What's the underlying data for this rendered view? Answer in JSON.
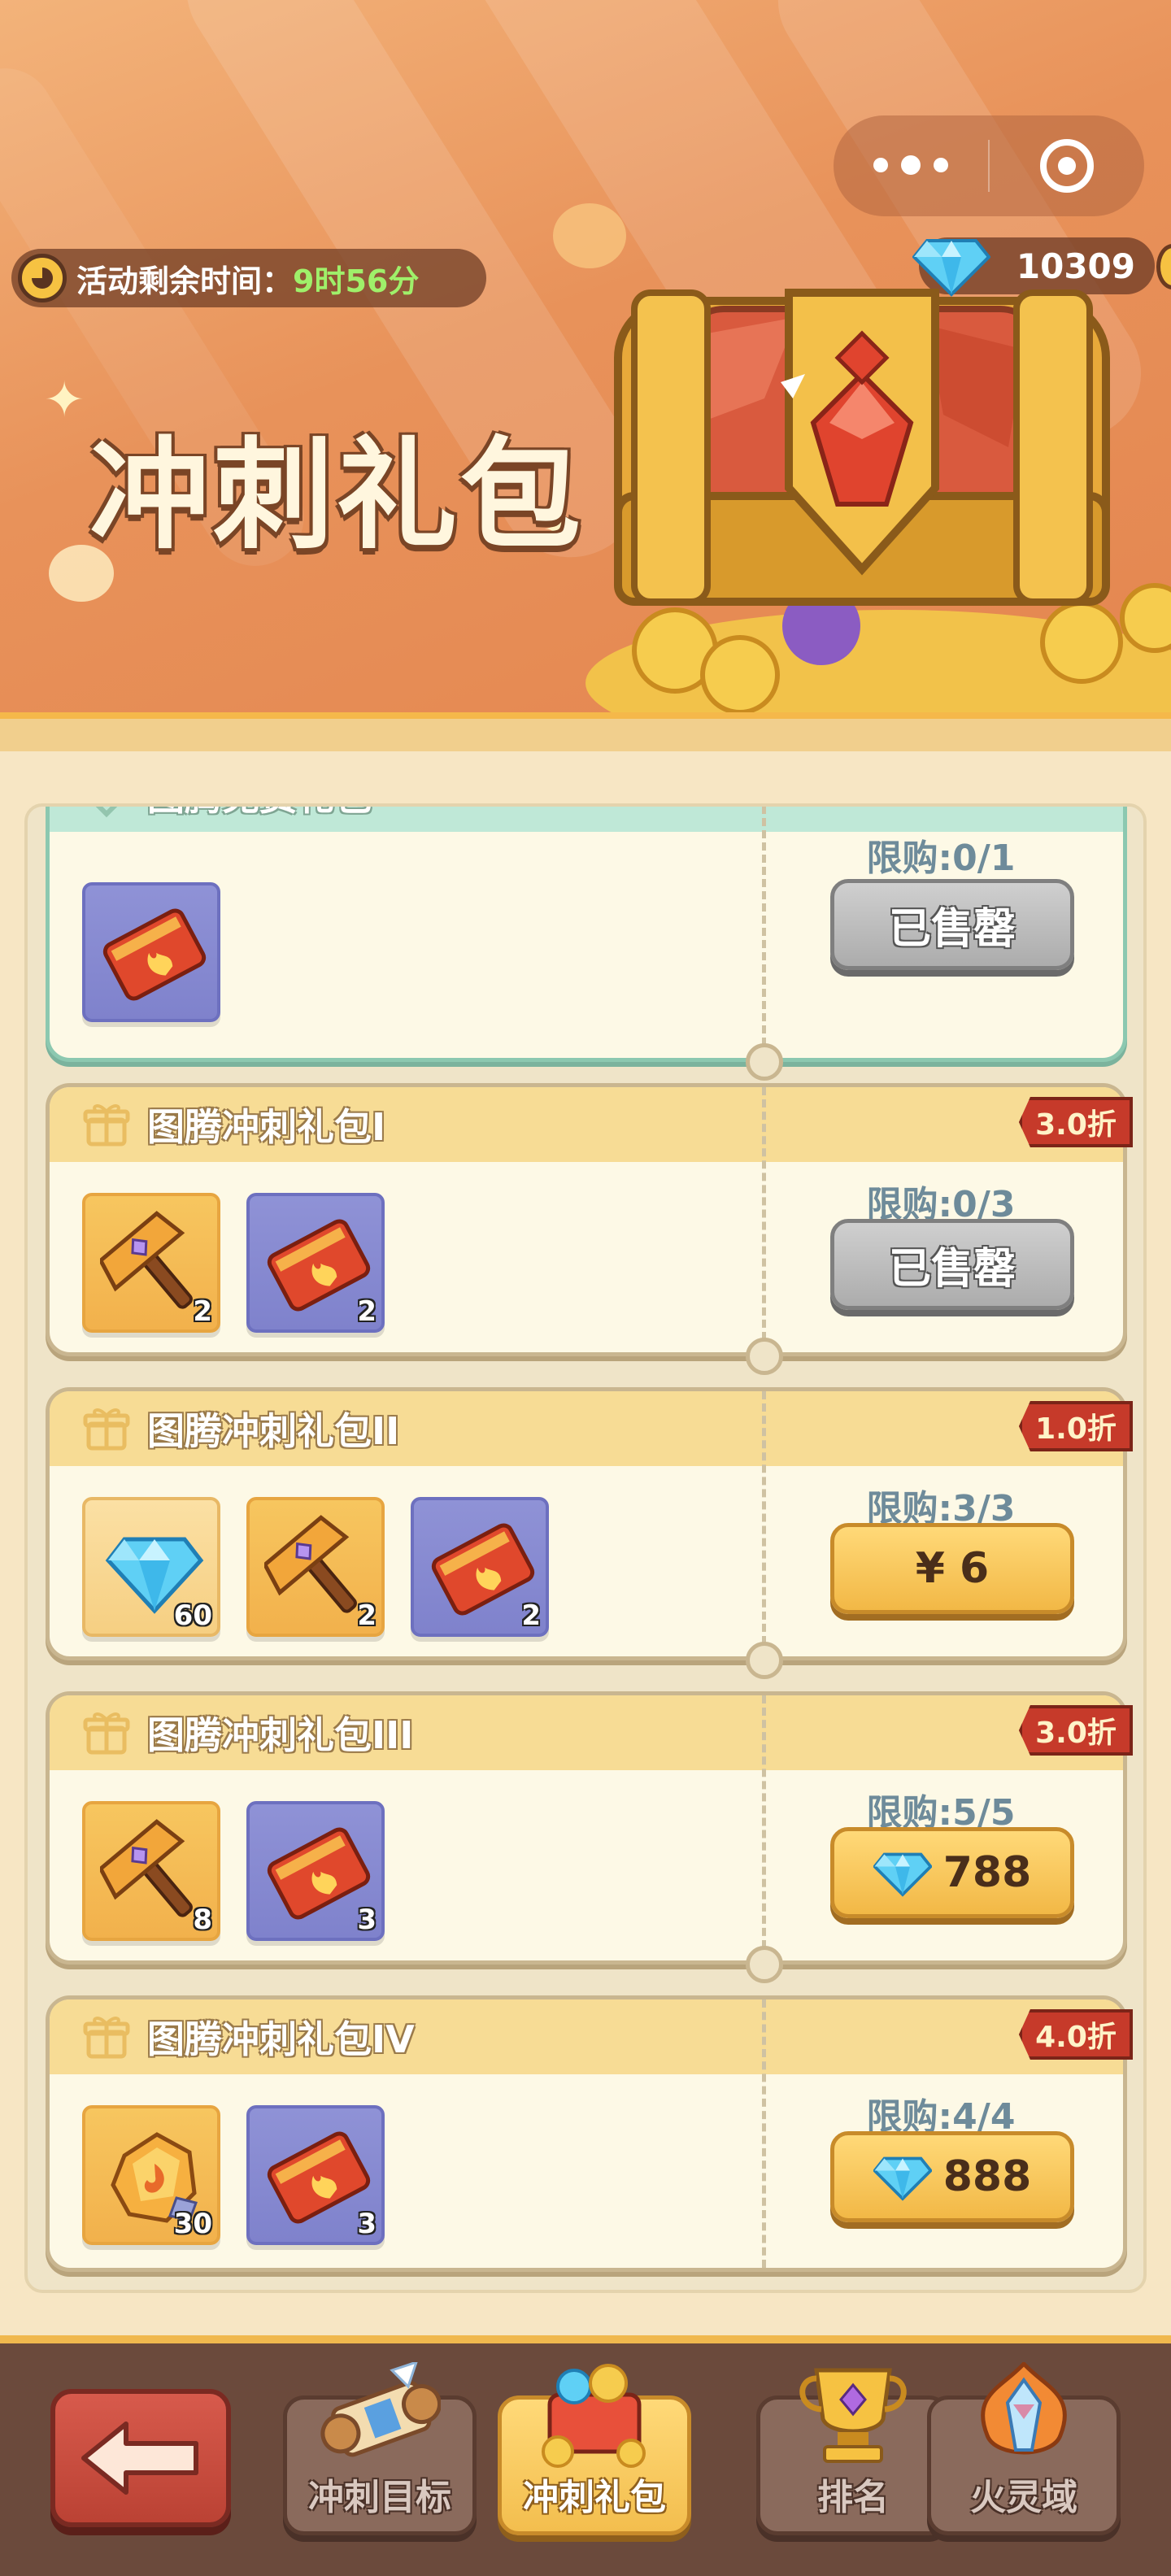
{
  "header": {
    "timer_label": "活动剩余时间：",
    "timer_value": "9时56分",
    "diamond_count": "10309",
    "title": "冲刺礼包"
  },
  "packs": [
    {
      "title": "图腾免费礼包",
      "limit": "限购:0/1",
      "button": "已售罄",
      "button_state": "sold",
      "items": [
        {
          "icon": "ticket-icon",
          "bg": "purple",
          "qty": ""
        }
      ]
    },
    {
      "title": "图腾冲刺礼包I",
      "discount": "3.0折",
      "limit": "限购:0/3",
      "button": "已售罄",
      "button_state": "sold",
      "items": [
        {
          "icon": "hammer-icon",
          "bg": "gold",
          "qty": "2"
        },
        {
          "icon": "ticket-icon",
          "bg": "purple",
          "qty": "2"
        }
      ]
    },
    {
      "title": "图腾冲刺礼包II",
      "discount": "1.0折",
      "limit": "限购:3/3",
      "button": "¥ 6",
      "button_state": "price",
      "items": [
        {
          "icon": "diamond-icon",
          "bg": "light",
          "qty": "60"
        },
        {
          "icon": "hammer-icon",
          "bg": "gold",
          "qty": "2"
        },
        {
          "icon": "ticket-icon",
          "bg": "purple",
          "qty": "2"
        }
      ]
    },
    {
      "title": "图腾冲刺礼包III",
      "discount": "3.0折",
      "limit": "限购:5/5",
      "button": "788",
      "button_state": "diamond",
      "items": [
        {
          "icon": "hammer-icon",
          "bg": "gold",
          "qty": "8"
        },
        {
          "icon": "ticket-icon",
          "bg": "purple",
          "qty": "3"
        }
      ]
    },
    {
      "title": "图腾冲刺礼包IV",
      "discount": "4.0折",
      "limit": "限购:4/4",
      "button": "888",
      "button_state": "diamond",
      "items": [
        {
          "icon": "fire-stone-icon",
          "bg": "gold",
          "qty": "30"
        },
        {
          "icon": "ticket-icon",
          "bg": "purple",
          "qty": "3"
        }
      ]
    }
  ],
  "nav": {
    "tabs": [
      {
        "label": "冲刺目标",
        "icon": "scroll-icon"
      },
      {
        "label": "冲刺礼包",
        "icon": "treasure-icon",
        "active": true
      },
      {
        "label": "排名",
        "icon": "trophy-icon"
      },
      {
        "label": "火灵域",
        "icon": "flame-crystal-icon"
      }
    ]
  },
  "colors": {
    "banner": "#e8925a",
    "gold_button": "#f2b846",
    "discount_tag": "#c63a2a",
    "limit_text": "#6e8b9a"
  }
}
